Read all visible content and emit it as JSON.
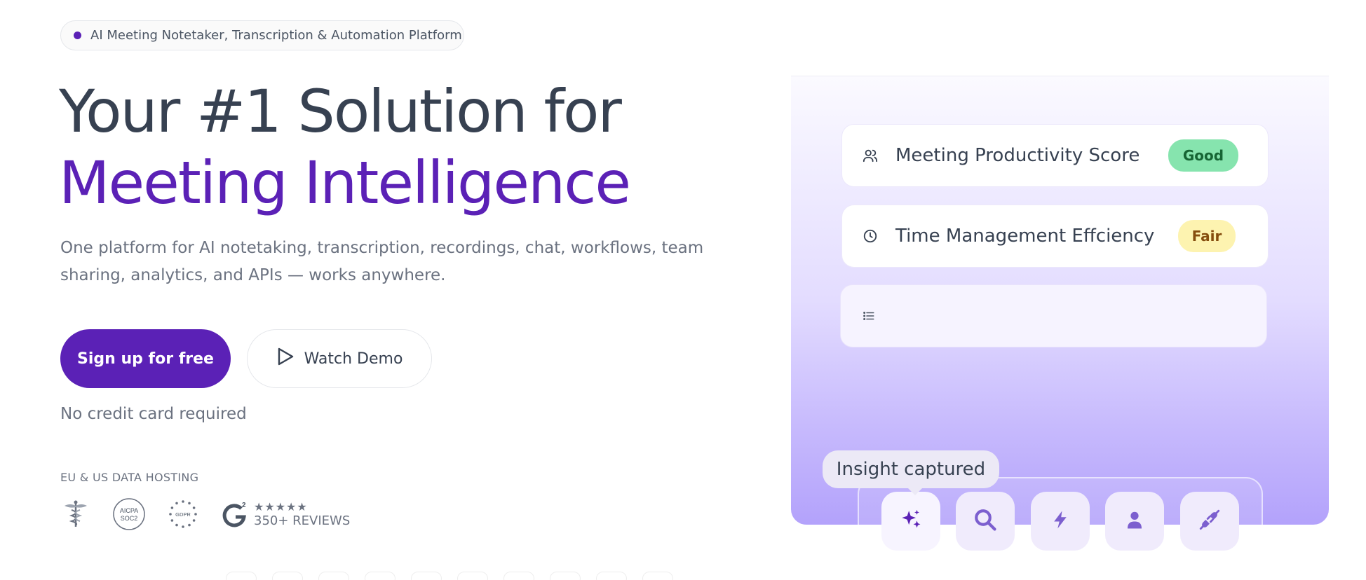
{
  "badge": {
    "text": "AI Meeting Notetaker, Transcription & Automation Platform"
  },
  "hero": {
    "headline_line1": "Your #1 Solution for",
    "headline_line2": "Meeting Intelligence",
    "subtext": "One platform for AI notetaking, transcription, recordings, chat, workflows, team sharing, analytics, and APIs — works anywhere.",
    "primary_cta": "Sign up for free",
    "secondary_cta": "Watch Demo",
    "note": "No credit card required"
  },
  "trust": {
    "hosting_label": "EU & US DATA HOSTING",
    "stars": "★★★★★",
    "reviews": "350+ REVIEWS",
    "badges": [
      "medical-caduceus-icon",
      "aicpa-soc2-icon",
      "gdpr-icon",
      "g2-icon"
    ],
    "aicpa_line1": "AICPA",
    "aicpa_line2": "SOC2",
    "gdpr_text": "GDPR"
  },
  "panel": {
    "cards": [
      {
        "icon": "users-icon",
        "label": "Meeting Productivity Score",
        "status": "Good"
      },
      {
        "icon": "clock-icon",
        "label": "Time Management Effciency",
        "status": "Fair"
      },
      {
        "icon": "list-icon",
        "label": "",
        "status": ""
      }
    ],
    "tooltip": "Insight captured",
    "dock": [
      "sparkles-icon",
      "search-icon",
      "bolt-icon",
      "user-icon",
      "plug-icon"
    ]
  },
  "colors": {
    "brand": "#5b21b6",
    "good": "#86e4ae",
    "fair": "#fdf3b0"
  }
}
